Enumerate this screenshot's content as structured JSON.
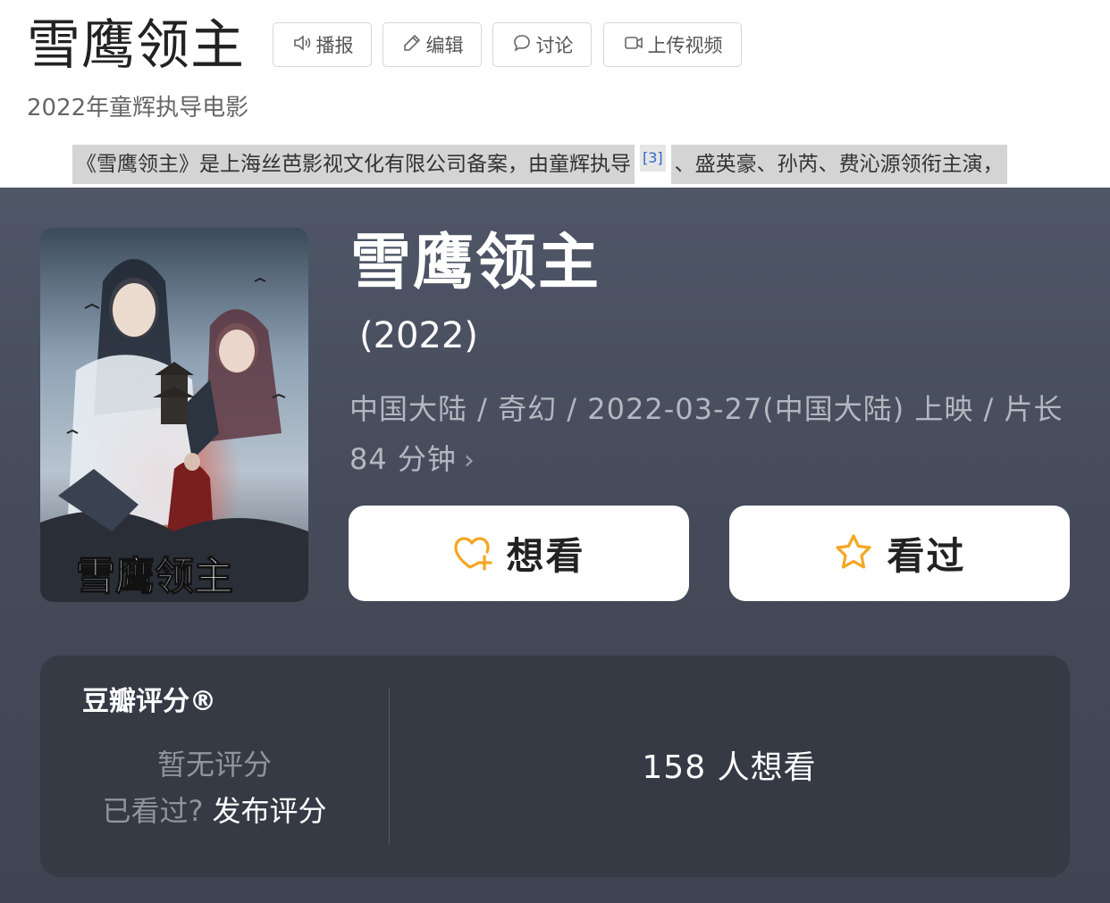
{
  "baike": {
    "title": "雪鹰领主",
    "buttons": {
      "broadcast": "播报",
      "edit": "编辑",
      "discuss": "讨论",
      "upload_video": "上传视频"
    },
    "subtitle": "2022年童辉执导电影",
    "summary_part1": "《雪鹰领主》是上海丝芭影视文化有限公司备案，由童辉执导",
    "summary_ref": "[3]",
    "summary_part2": "、盛英豪、孙芮、费沁源领衔主演，"
  },
  "movie": {
    "poster_text": "雪鹰领主",
    "title": "雪鹰领主",
    "year": "(2022)",
    "meta": "中国大陆 / 奇幻 / 2022-03-27(中国大陆) 上映 / 片长 84 分钟",
    "meta_chevron": "›",
    "want_label": "想看",
    "watched_label": "看过"
  },
  "rating": {
    "label": "豆瓣评分®",
    "no_rating": "暂无评分",
    "seen_question": "已看过?",
    "publish_label": "发布评分",
    "want_count": "158 人想看"
  },
  "colors": {
    "accent_orange": "#f5a623",
    "card_bg": "#4b5161",
    "rating_bg": "#353a45"
  },
  "icons": {
    "broadcast": "speaker-icon",
    "edit": "pencil-icon",
    "discuss": "chat-bubble-icon",
    "upload": "video-camera-icon",
    "want": "heart-plus-icon",
    "watched": "star-icon"
  }
}
